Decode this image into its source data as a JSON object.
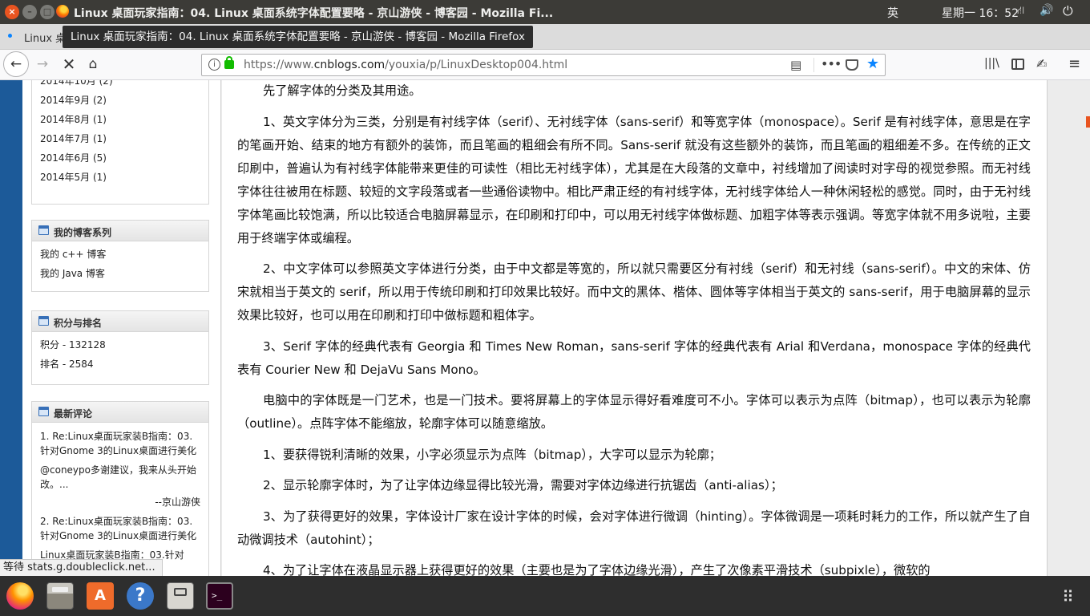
{
  "panel": {
    "window_title": "Linux 桌面玩家指南：04. Linux 桌面系统字体配置要略 - 京山游侠 - 博客园 - Mozilla Fi...",
    "ime": "英",
    "clock": "星期一 16：52",
    "close_glyph": "×",
    "min_glyph": "–",
    "max_glyph": "□"
  },
  "tabs": {
    "active_label": "Linux 桌面玩家指南：",
    "tooltip": "Linux 桌面玩家指南：04. Linux 桌面系统字体配置要略 - 京山游侠 - 博客园 - Mozilla Firefox"
  },
  "navbar": {
    "back_glyph": "←",
    "forward_glyph": "→",
    "stop_glyph": "✕",
    "home_glyph": "⌂",
    "info_glyph": "i",
    "url_prefix": "https://www.",
    "url_host": "cnblogs.com",
    "url_path": "/youxia/p/LinuxDesktop004.html",
    "reader_glyph": "▤",
    "page_actions_glyph": "•••",
    "star_glyph": "★",
    "library_glyph": "|||\\",
    "ext_glyph": "✍",
    "menu_glyph": "≡"
  },
  "sidebar": {
    "archive": [
      "2014年10月 (2)",
      "2014年9月 (2)",
      "2014年8月 (1)",
      "2014年7月 (1)",
      "2014年6月 (5)",
      "2014年5月 (1)"
    ],
    "series": {
      "title": "我的博客系列",
      "items": [
        "我的 c++ 博客",
        "我的 Java 博客"
      ]
    },
    "score": {
      "title": "积分与排名",
      "items": [
        "积分 - 132128",
        "排名 - 2584"
      ]
    },
    "comments": {
      "title": "最新评论",
      "c1_title": "1. Re:Linux桌面玩家装B指南：03. 针对Gnome 3的Linux桌面进行美化",
      "c1_body": "@coneypo多谢建议，我来从头开始改。...",
      "c1_author": "--京山游侠",
      "c2_title": "2. Re:Linux桌面玩家装B指南：03. 针对Gnome 3的Linux桌面进行美化",
      "c2_body": "Linux桌面玩家装B指南：03.针对"
    }
  },
  "article": {
    "paragraphs": [
      "先了解字体的分类及其用途。",
      "1、英文字体分为三类，分别是有衬线字体（serif）、无衬线字体（sans-serif）和等宽字体（monospace）。Serif 是有衬线字体，意思是在字的笔画开始、结束的地方有额外的装饰，而且笔画的粗细会有所不同。Sans-serif 就没有这些额外的装饰，而且笔画的粗细差不多。在传统的正文印刷中，普遍认为有衬线字体能带来更佳的可读性（相比无衬线字体），尤其是在大段落的文章中，衬线增加了阅读时对字母的视觉参照。而无衬线字体往往被用在标题、较短的文字段落或者一些通俗读物中。相比严肃正经的有衬线字体，无衬线字体给人一种休闲轻松的感觉。同时，由于无衬线字体笔画比较饱满，所以比较适合电脑屏幕显示，在印刷和打印中，可以用无衬线字体做标题、加粗字体等表示强调。等宽字体就不用多说啦，主要用于终端字体或编程。",
      "2、中文字体可以参照英文字体进行分类，由于中文都是等宽的，所以就只需要区分有衬线（serif）和无衬线（sans-serif）。中文的宋体、仿宋就相当于英文的 serif，所以用于传统印刷和打印效果比较好。而中文的黑体、楷体、圆体等字体相当于英文的 sans-serif，用于电脑屏幕的显示效果比较好，也可以用在印刷和打印中做标题和粗体字。",
      "3、Serif 字体的经典代表有 Georgia 和 Times New Roman，sans-serif 字体的经典代表有 Arial 和Verdana，monospace 字体的经典代表有 Courier New 和 DejaVu Sans Mono。",
      "电脑中的字体既是一门艺术，也是一门技术。要将屏幕上的字体显示得好看难度可不小。字体可以表示为点阵（bitmap），也可以表示为轮廓（outline）。点阵字体不能缩放，轮廓字体可以随意缩放。",
      "1、要获得锐利清晰的效果，小字必须显示为点阵（bitmap），大字可以显示为轮廓；",
      "2、显示轮廓字体时，为了让字体边缘显得比较光滑，需要对字体边缘进行抗锯齿（anti-alias）；",
      "3、为了获得更好的效果，字体设计厂家在设计字体的时候，会对字体进行微调（hinting）。字体微调是一项耗时耗力的工作，所以就产生了自动微调技术（autohint）；",
      "4、为了让字体在液晶显示器上获得更好的效果（主要也是为了字体边缘光滑），产生了次像素平滑技术（subpixle），微软的"
    ]
  },
  "status": {
    "text": "等待 stats.g.doubleclick.net..."
  },
  "dock": {
    "software_glyph": "A",
    "help_glyph": "?",
    "terminal_glyph": ">_",
    "apps_glyph": "⠿"
  }
}
